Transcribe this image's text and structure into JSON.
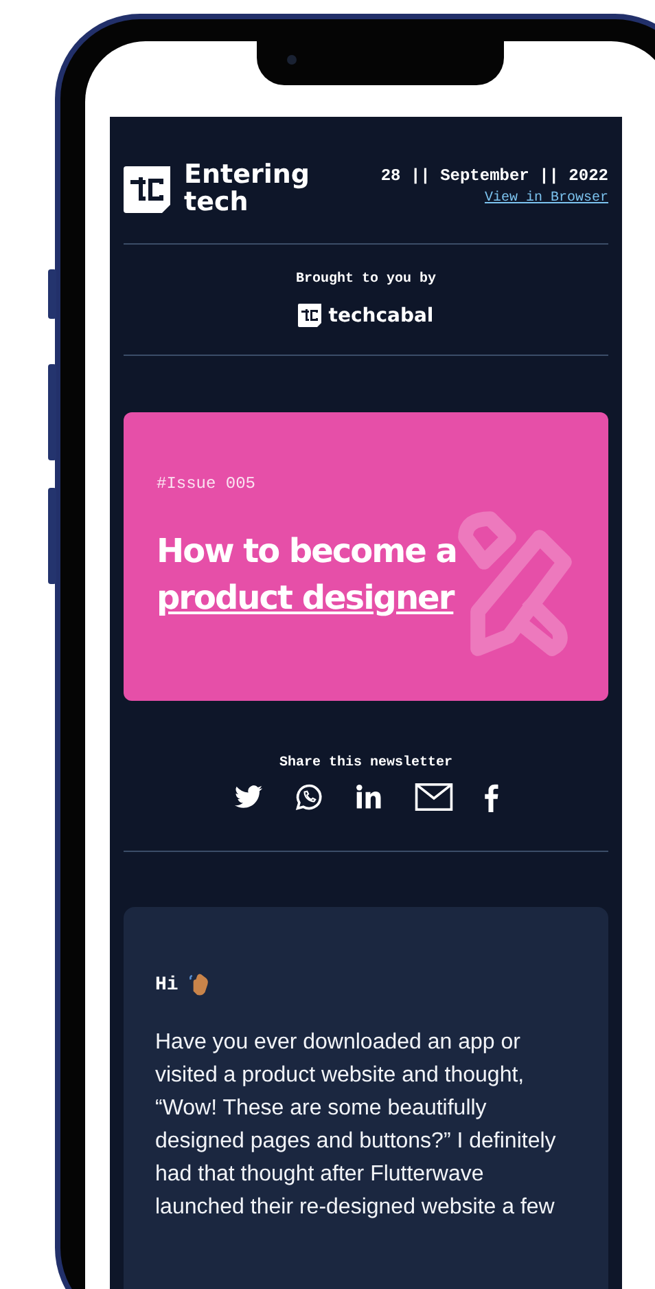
{
  "header": {
    "title": "Entering tech",
    "date": "28 || September || 2022",
    "view_link": "View in Browser"
  },
  "sponsor": {
    "label": "Brought to you by",
    "name": "techcabal"
  },
  "hero": {
    "issue": "#Issue 005",
    "title": "How to become a",
    "title_link": "product designer"
  },
  "share": {
    "label": "Share this newsletter",
    "buttons": [
      {
        "kind": "twitter"
      },
      {
        "kind": "whatsapp"
      },
      {
        "kind": "linkedin"
      },
      {
        "kind": "email"
      },
      {
        "kind": "facebook"
      }
    ]
  },
  "letter": {
    "greeting": "Hi",
    "body": "Have you ever downloaded an app or visited a product website and thought, “Wow! These are some beautifully designed pages and buttons?” I definitely had that thought after Flutterwave launched their re-designed website a few"
  }
}
